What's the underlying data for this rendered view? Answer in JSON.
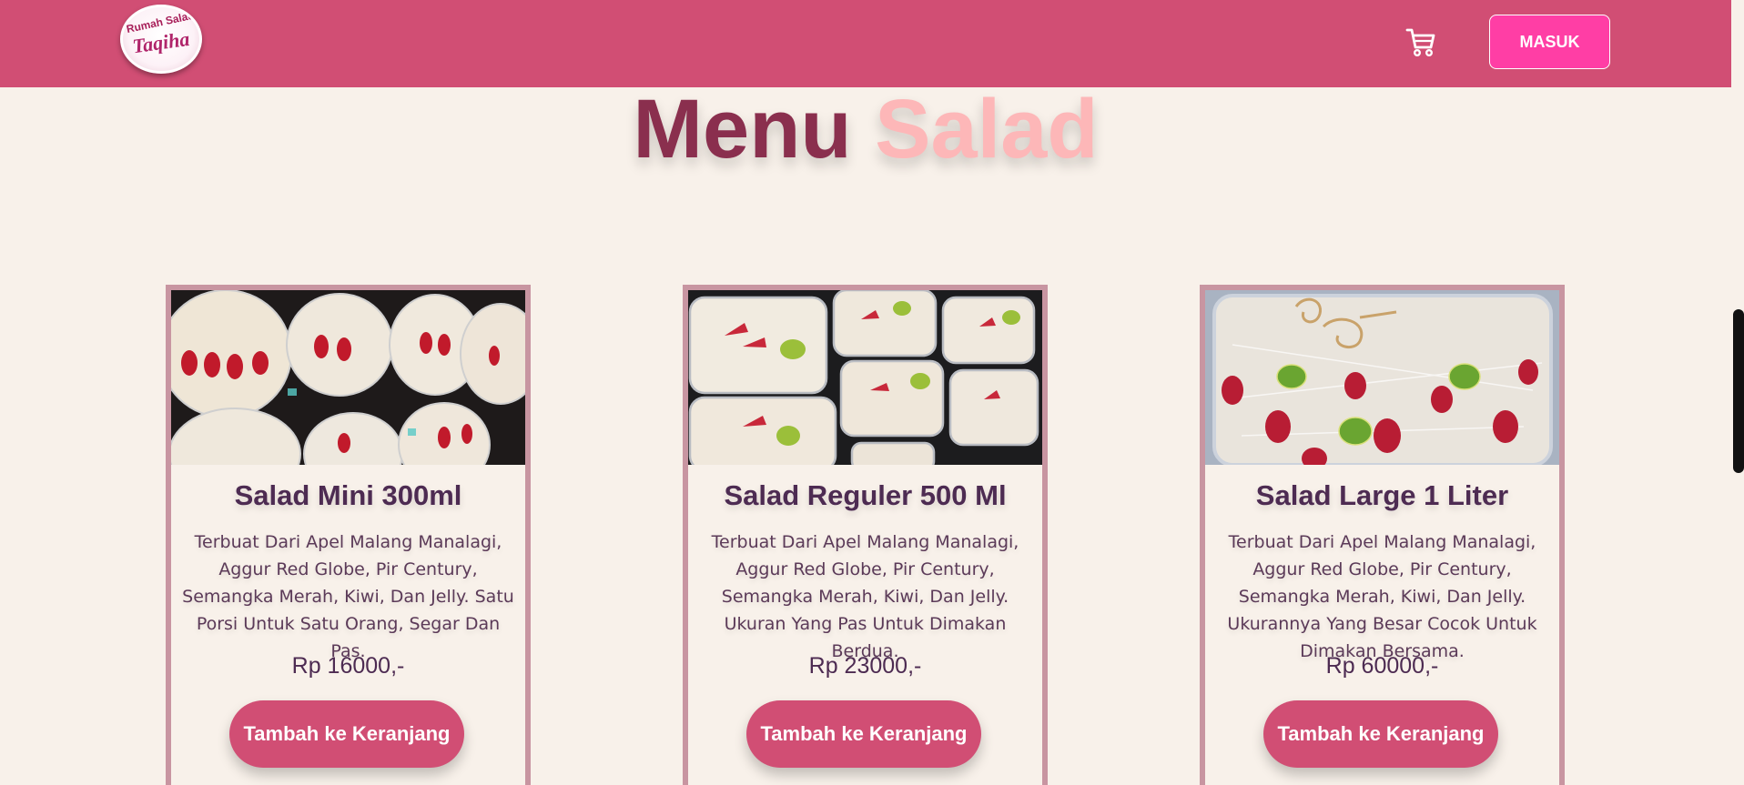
{
  "header": {
    "logo_alt": "Rumah Salad Taqiha",
    "logo_line1": "Rumah Salad",
    "logo_line2": "Taqiha",
    "cart_icon": "cart-icon",
    "login_label": "MASUK"
  },
  "page": {
    "title_part1": "Menu",
    "title_part2": "Salad"
  },
  "products": [
    {
      "name": "Salad Mini 300ml",
      "description": "Terbuat Dari Apel Malang Manalagi, Aggur Red Globe, Pir Century, Semangka Merah, Kiwi, Dan Jelly. Satu Porsi Untuk Satu Orang, Segar Dan Pas.",
      "price": "Rp 16000,-",
      "button_label": "Tambah ke Keranjang"
    },
    {
      "name": "Salad Reguler 500 Ml",
      "description": "Terbuat Dari Apel Malang Manalagi, Aggur Red Globe, Pir Century, Semangka Merah, Kiwi, Dan Jelly. Ukuran Yang Pas Untuk Dimakan Berdua.",
      "price": "Rp 23000,-",
      "button_label": "Tambah ke Keranjang"
    },
    {
      "name": "Salad Large 1 Liter",
      "description": "Terbuat Dari Apel Malang Manalagi, Aggur Red Globe, Pir Century, Semangka Merah, Kiwi, Dan Jelly. Ukurannya Yang Besar Cocok Untuk Dimakan Bersama.",
      "price": "Rp 60000,-",
      "button_label": "Tambah ke Keranjang"
    }
  ],
  "colors": {
    "navbar": "#d14e74",
    "login_button": "#ff3ea5",
    "title_dark": "#8a2f4e",
    "title_light": "#fdb7b8",
    "card_border": "#c895a1",
    "background": "#f8f1ea"
  }
}
